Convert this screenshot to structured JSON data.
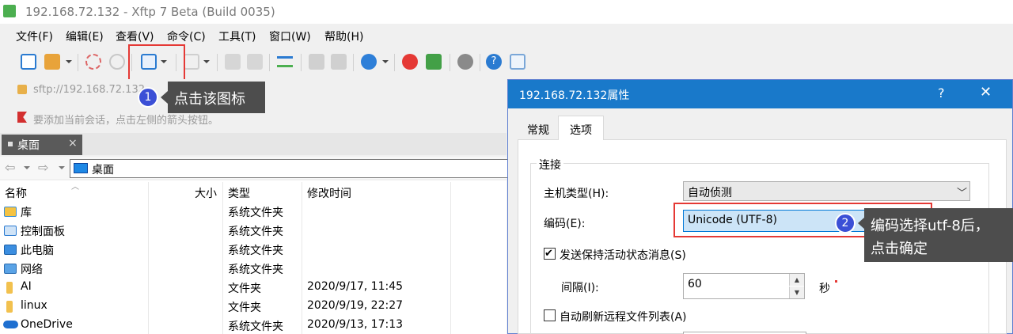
{
  "window": {
    "title": "192.168.72.132 - Xftp 7 Beta (Build 0035)"
  },
  "menu": [
    "文件(F)",
    "编辑(E)",
    "查看(V)",
    "命令(C)",
    "工具(T)",
    "窗口(W)",
    "帮助(H)"
  ],
  "address": {
    "text": "sftp://192.168.72.132"
  },
  "hint": "要添加当前会话，点击左侧的箭头按钮。",
  "tab": {
    "label": "桌面",
    "close": "×"
  },
  "path": "桌面",
  "columns": {
    "name": "名称",
    "size": "大小",
    "type": "类型",
    "mtime": "修改时间"
  },
  "files": [
    {
      "name": "库",
      "type": "系统文件夹",
      "mtime": "",
      "icon": "library-icon"
    },
    {
      "name": "控制面板",
      "type": "系统文件夹",
      "mtime": "",
      "icon": "control-panel-icon"
    },
    {
      "name": "此电脑",
      "type": "系统文件夹",
      "mtime": "",
      "icon": "computer-icon"
    },
    {
      "name": "网络",
      "type": "系统文件夹",
      "mtime": "",
      "icon": "network-icon"
    },
    {
      "name": "AI",
      "type": "文件夹",
      "mtime": "2020/9/17, 11:45",
      "icon": "folder-icon"
    },
    {
      "name": "linux",
      "type": "文件夹",
      "mtime": "2020/9/19, 22:27",
      "icon": "folder-icon"
    },
    {
      "name": "OneDrive",
      "type": "系统文件夹",
      "mtime": "2020/9/13, 17:13",
      "icon": "onedrive-icon"
    }
  ],
  "annotations": {
    "step1_num": "1",
    "step1_text": "点击该图标",
    "step2_num": "2",
    "step2_line1": "编码选择utf-8后，",
    "step2_line2": "点击确定"
  },
  "dialog": {
    "title": "192.168.72.132属性",
    "help": "?",
    "close": "✕",
    "tabs": [
      "常规",
      "选项"
    ],
    "active_tab": "选项",
    "group_title": "连接",
    "host_type_label": "主机类型(H):",
    "host_type_value": "自动侦测",
    "encoding_label": "编码(E):",
    "encoding_value": "Unicode (UTF-8)",
    "keepalive_label": "发送保持活动状态消息(S)",
    "keepalive_checked": true,
    "interval_label": "间隔(I):",
    "interval_value": "60",
    "interval_unit": "秒",
    "autorefresh_label": "自动刷新远程文件列表(A)",
    "autorefresh_checked": false
  },
  "colors": {
    "accent": "#1979ca",
    "highlight": "#e53935",
    "badge": "#3b4fd6",
    "tooltip": "#4d4d4d"
  }
}
